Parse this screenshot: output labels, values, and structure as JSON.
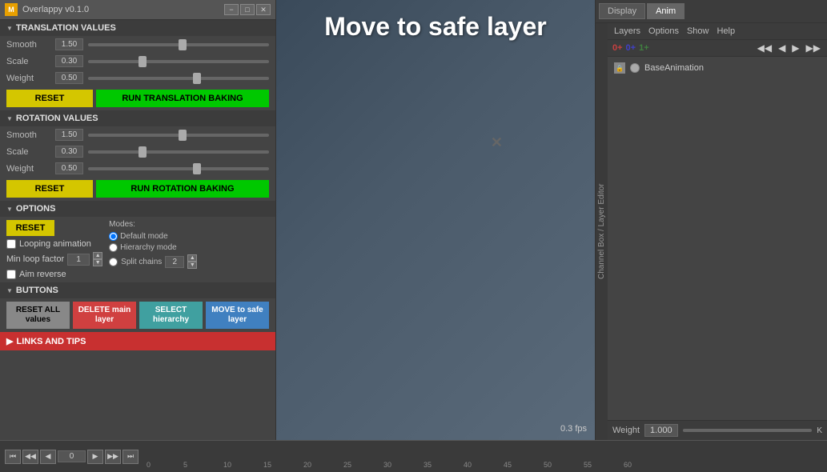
{
  "app": {
    "title": "Overlappy v0.1.0",
    "icon": "M"
  },
  "viewport": {
    "title": "Move to safe layer",
    "fps": "0.3 fps"
  },
  "translation": {
    "header": "TRANSLATION VALUES",
    "smooth_label": "Smooth",
    "smooth_value": "1.50",
    "smooth_pct": 55,
    "scale_label": "Scale",
    "scale_value": "0.30",
    "scale_pct": 30,
    "weight_label": "Weight",
    "weight_value": "0.50",
    "weight_pct": 60,
    "reset_label": "RESET",
    "run_label": "RUN TRANSLATION BAKING"
  },
  "rotation": {
    "header": "ROTATION VALUES",
    "smooth_label": "Smooth",
    "smooth_value": "1.50",
    "smooth_pct": 55,
    "scale_label": "Scale",
    "scale_value": "0.30",
    "scale_pct": 30,
    "weight_label": "Weight",
    "weight_value": "0.50",
    "weight_pct": 60,
    "reset_label": "RESET",
    "run_label": "RUN ROTATION BAKING"
  },
  "options": {
    "header": "OPTIONS",
    "reset_label": "RESET",
    "looping_label": "Looping animation",
    "min_loop_label": "Min loop factor",
    "min_loop_value": "1",
    "aim_label": "Aim reverse",
    "modes_label": "Modes:",
    "mode_default": "Default mode",
    "mode_hierarchy": "Hierarchy mode",
    "mode_split": "Split chains",
    "split_value": "2"
  },
  "buttons": {
    "header": "BUTTONS",
    "reset_all_label": "RESET ALL values",
    "delete_label": "DELETE main layer",
    "select_label": "SELECT hierarchy",
    "move_label": "MOVE to safe layer"
  },
  "links": {
    "label": "LINKS AND TIPS"
  },
  "channel_box": {
    "display_tab": "Display",
    "anim_tab": "Anim",
    "vertical_label": "Channel Box / Layer Editor",
    "menus": [
      "Layers",
      "Options",
      "Show",
      "Help"
    ],
    "base_animation": "BaseAnimation",
    "weight_label": "Weight",
    "weight_value": "1.000"
  },
  "timeline": {
    "ticks": [
      0,
      5,
      10,
      15,
      20,
      25,
      30,
      35,
      40,
      45,
      50,
      55,
      60
    ],
    "current_frame": "0"
  },
  "playback": {
    "buttons": [
      "⏮",
      "◀◀",
      "◀",
      "▶",
      "▶▶",
      "⏭"
    ]
  }
}
